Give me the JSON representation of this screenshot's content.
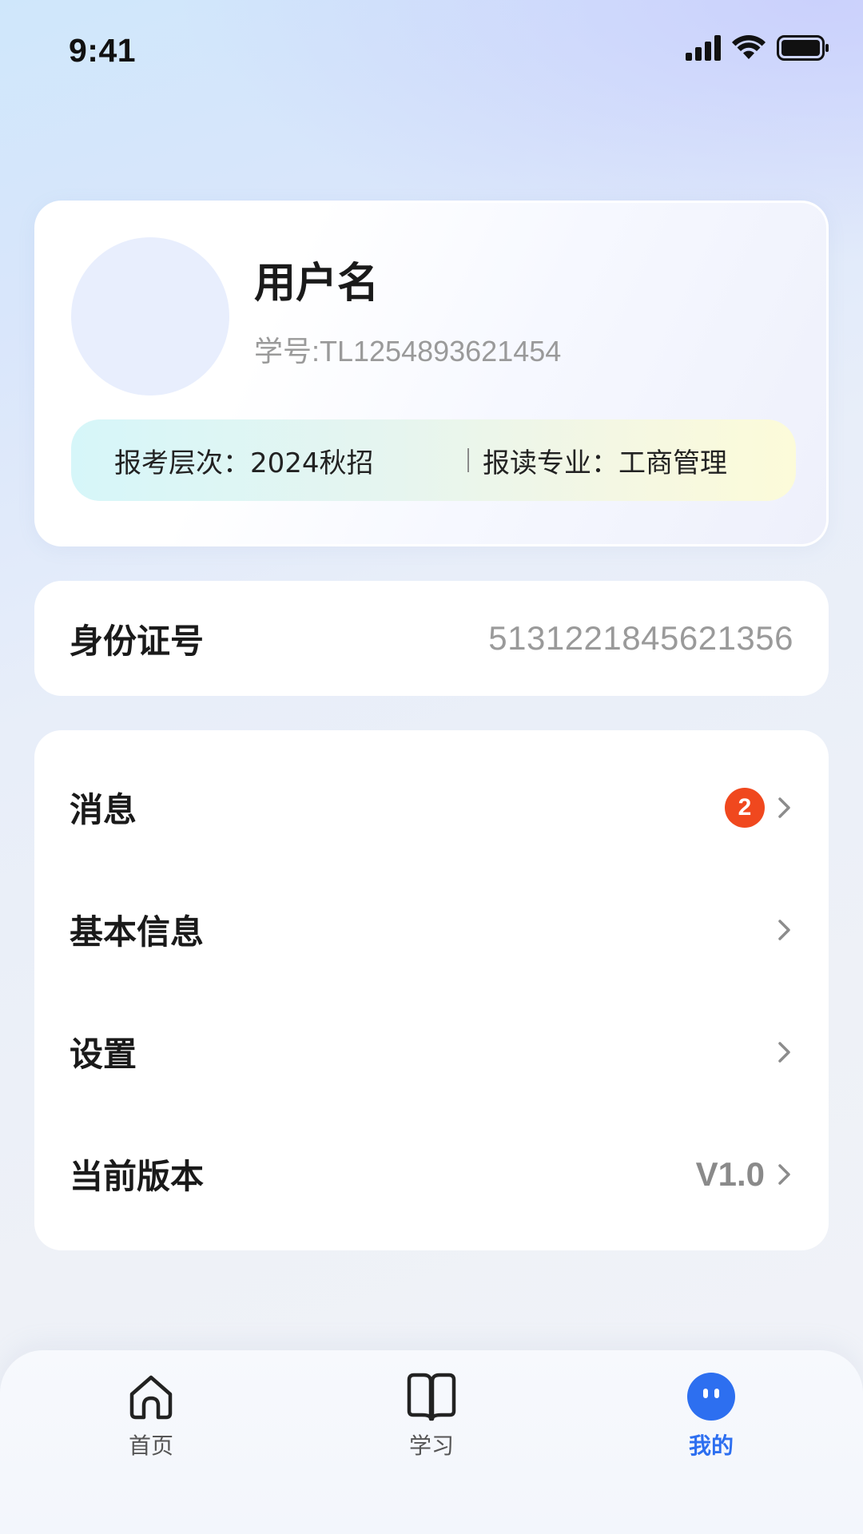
{
  "status_bar": {
    "time": "9:41",
    "icons": [
      "signal-icon",
      "wifi-icon",
      "battery-icon"
    ]
  },
  "profile": {
    "username": "用户名",
    "student_id": "学号:TL1254893621454",
    "exam_level": "报考层次：2024秋招",
    "major": "报读专业：工商管理"
  },
  "id_card": {
    "label": "身份证号",
    "value": "5131221845621356"
  },
  "menu": {
    "items": [
      {
        "label": "消息",
        "badge": "2",
        "icon": "chevron-right-icon"
      },
      {
        "label": "基本信息",
        "icon": "chevron-right-icon"
      },
      {
        "label": "设置",
        "icon": "chevron-right-icon"
      },
      {
        "label": "当前版本",
        "value": "V1.0",
        "icon": "chevron-right-icon"
      }
    ]
  },
  "bottom_nav": {
    "items": [
      {
        "label": "首页",
        "icon": "home-icon",
        "active": false
      },
      {
        "label": "学习",
        "icon": "book-icon",
        "active": false
      },
      {
        "label": "我的",
        "icon": "profile-face-icon",
        "active": true
      }
    ]
  },
  "colors": {
    "accent": "#2d6ff0",
    "badge": "#f0481e",
    "muted_text": "#9a9a9a"
  }
}
